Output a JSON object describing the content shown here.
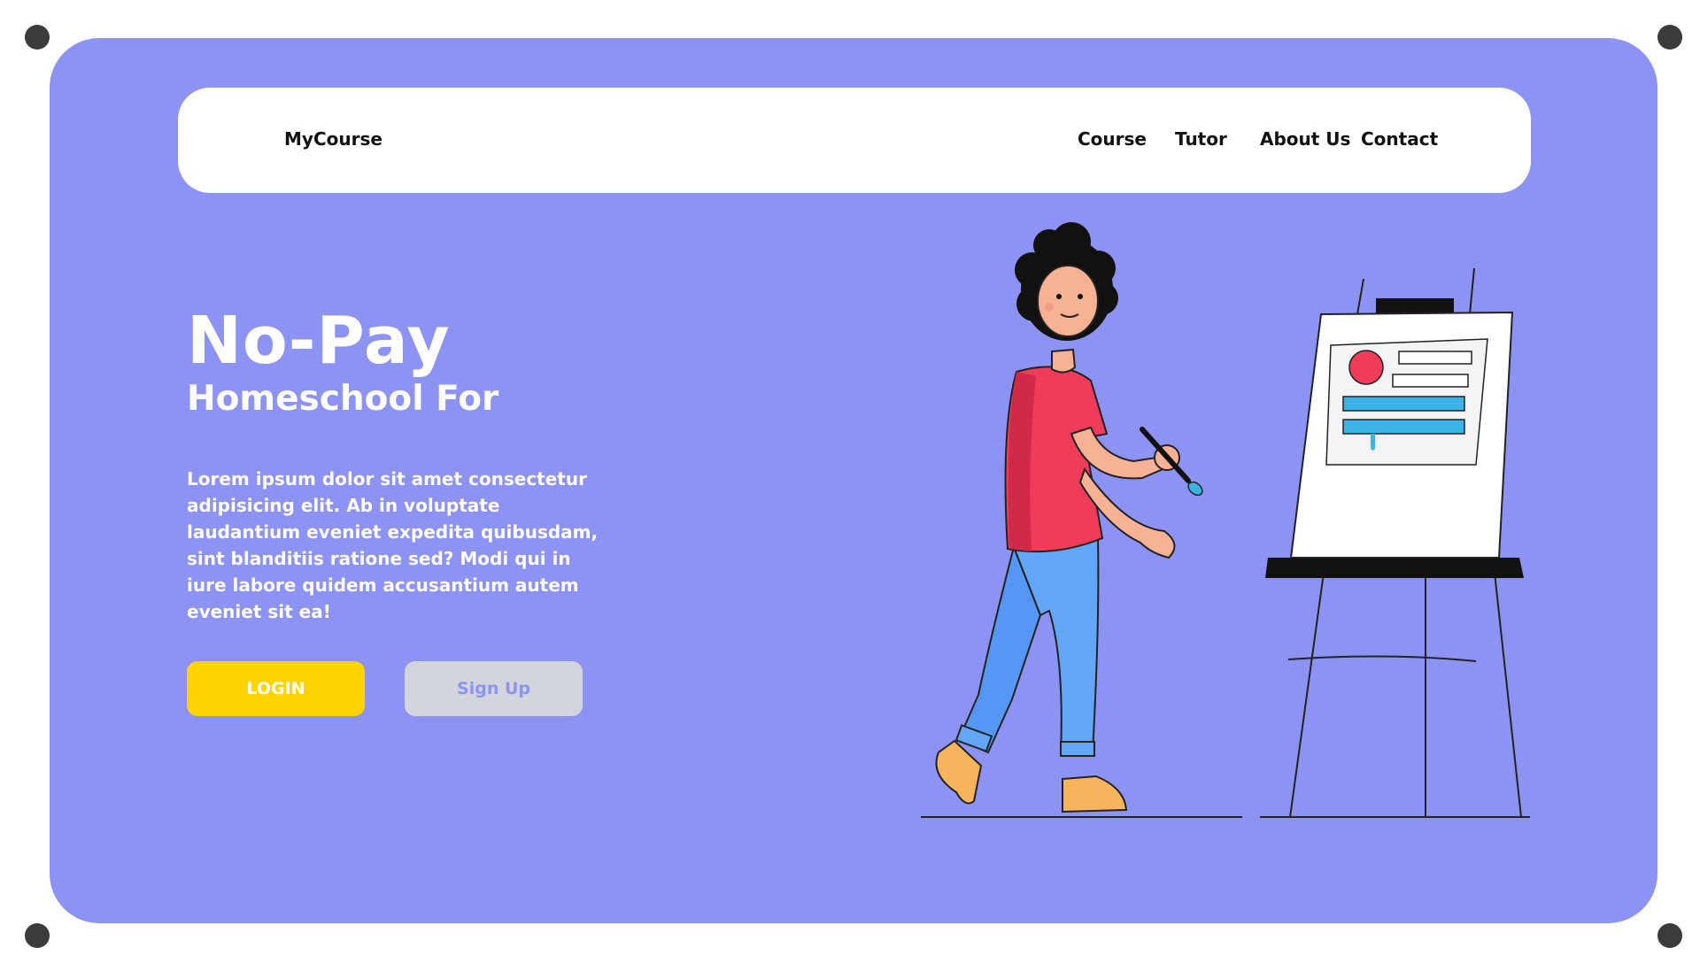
{
  "colors": {
    "frame_bg": "#8d93f2",
    "navbar_bg": "#ffffff",
    "login_bg": "#ffd400",
    "signup_bg": "#d2d5dd",
    "signup_text": "#8d93f2"
  },
  "nav": {
    "brand": "MyCourse",
    "links": [
      "Course",
      "Tutor",
      "About Us",
      "Contact"
    ]
  },
  "hero": {
    "title": "No-Pay",
    "subtitle": "Homeschool For",
    "body": "Lorem ipsum dolor sit amet consectetur adipisicing elit. Ab in voluptate laudantium eveniet expedita quibusdam, sint blanditiis ratione sed? Modi qui in iure labore quidem accusantium autem eveniet sit ea!",
    "login_label": "LOGIN",
    "signup_label": "Sign Up"
  },
  "illustration": {
    "icon": "girl-painting-at-easel-illustration"
  }
}
